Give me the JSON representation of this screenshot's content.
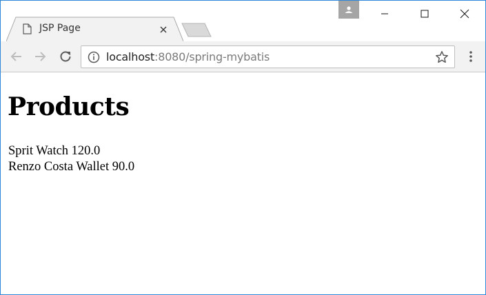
{
  "browser": {
    "tab": {
      "title": "JSP Page"
    },
    "address_bar": {
      "host": "localhost",
      "rest": ":8080/spring-mybatis"
    },
    "icons": {
      "tab_doc": "document-icon",
      "tab_close": "close-icon",
      "profile": "person-icon",
      "minimize": "minimize-icon",
      "maximize": "maximize-icon",
      "close": "close-icon",
      "back": "arrow-left-icon",
      "forward": "arrow-right-icon",
      "reload": "reload-icon",
      "info": "info-icon",
      "bookmark": "star-icon",
      "menu": "kebab-menu-icon"
    }
  },
  "page": {
    "heading": "Products",
    "products": [
      {
        "line": "Sprit Watch 120.0"
      },
      {
        "line": "Renzo Costa Wallet 90.0"
      }
    ]
  }
}
